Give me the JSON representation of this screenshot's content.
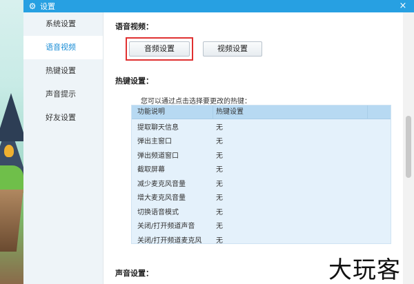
{
  "window": {
    "title": "设置",
    "close_glyph": "×"
  },
  "sidebar": {
    "items": [
      {
        "label": "系统设置",
        "active": false
      },
      {
        "label": "语音视频",
        "active": true
      },
      {
        "label": "热键设置",
        "active": false
      },
      {
        "label": "声音提示",
        "active": false
      },
      {
        "label": "好友设置",
        "active": false
      }
    ]
  },
  "voice_video": {
    "title": "语音视频：",
    "audio_button": "音频设置",
    "video_button": "视频设置"
  },
  "hotkeys": {
    "title": "热键设置：",
    "hint": "您可以通过点击选择要更改的热键：",
    "columns": [
      "功能说明",
      "热键设置"
    ],
    "rows": [
      {
        "name": "提取聊天信息",
        "key": "无"
      },
      {
        "name": "弹出主窗口",
        "key": "无"
      },
      {
        "name": "弹出频道窗口",
        "key": "无"
      },
      {
        "name": "截取屏幕",
        "key": "无"
      },
      {
        "name": "减少麦克风音量",
        "key": "无"
      },
      {
        "name": "增大麦克风音量",
        "key": "无"
      },
      {
        "name": "切换语音模式",
        "key": "无"
      },
      {
        "name": "关闭/打开频道声音",
        "key": "无"
      },
      {
        "name": "关闭/打开频道麦克风",
        "key": "无"
      }
    ]
  },
  "sound": {
    "title": "声音设置："
  },
  "watermark": "大玩客",
  "colors": {
    "titlebar": "#27a0e2",
    "active_item": "#1a8dd6",
    "highlight": "#e03030"
  }
}
